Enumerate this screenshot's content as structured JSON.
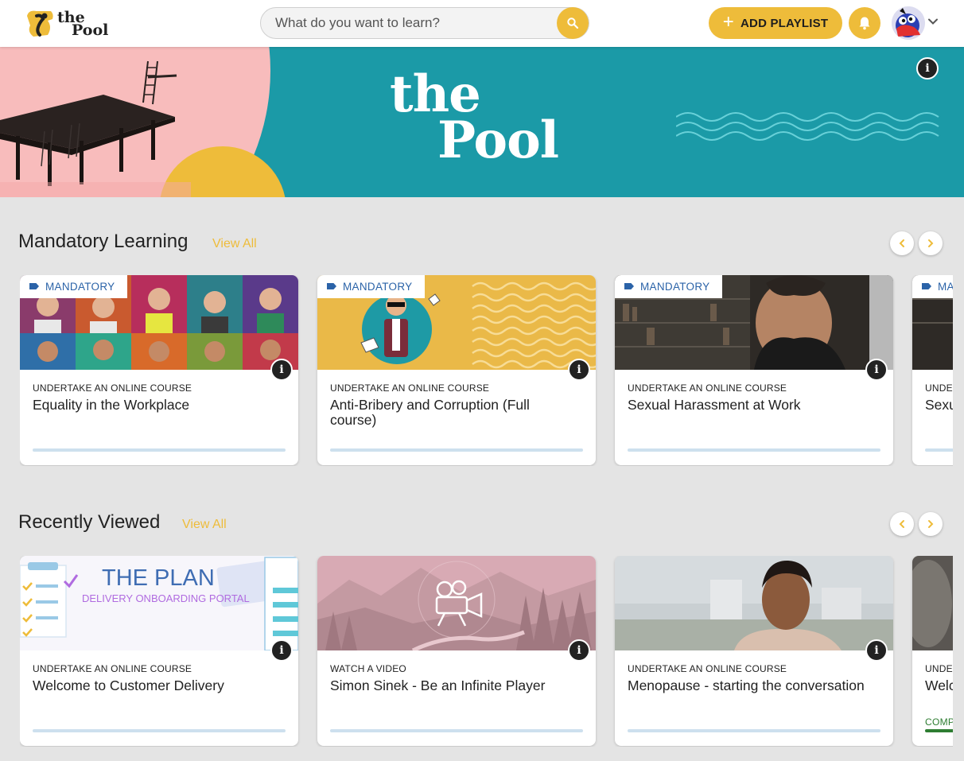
{
  "header": {
    "logo_line1": "the",
    "logo_line2": "Pool",
    "search_placeholder": "What do you want to learn?",
    "add_playlist_label": "ADD PLAYLIST"
  },
  "banner": {
    "title_line1": "the",
    "title_line2": "Pool"
  },
  "sections": {
    "mandatory": {
      "title": "Mandatory Learning",
      "view_all": "View All",
      "cards": [
        {
          "tag": "MANDATORY",
          "type": "UNDERTAKE AN ONLINE COURSE",
          "title": "Equality in the Workplace"
        },
        {
          "tag": "MANDATORY",
          "type": "UNDERTAKE AN ONLINE COURSE",
          "title": "Anti-Bribery and Corruption (Full course)"
        },
        {
          "tag": "MANDATORY",
          "type": "UNDERTAKE AN ONLINE COURSE",
          "title": "Sexual Harassment at Work"
        },
        {
          "tag": "MANDATORY",
          "type": "UNDERTAKE AN ONLINE COURSE",
          "title": "Sexual Harassment"
        }
      ]
    },
    "recent": {
      "title": "Recently Viewed",
      "view_all": "View All",
      "cards": [
        {
          "type": "UNDERTAKE AN ONLINE COURSE",
          "title": "Welcome to Customer Delivery",
          "thumb_title": "THE PLAN",
          "thumb_subtitle": "DELIVERY ONBOARDING PORTAL"
        },
        {
          "type": "WATCH A VIDEO",
          "title": "Simon Sinek - Be an Infinite Player"
        },
        {
          "type": "UNDERTAKE AN ONLINE COURSE",
          "title": "Menopause - starting the conversation"
        },
        {
          "type": "UNDERTAKE AN ONLINE COURSE",
          "title": "Welcome",
          "status": "COMPLETED"
        }
      ]
    }
  },
  "info_glyph": "i",
  "colors": {
    "accent": "#eebc3a",
    "teal": "#1b9aa7",
    "tag_blue": "#2b63a8",
    "progress": "#cde0ee",
    "completed": "#2e7d32"
  }
}
